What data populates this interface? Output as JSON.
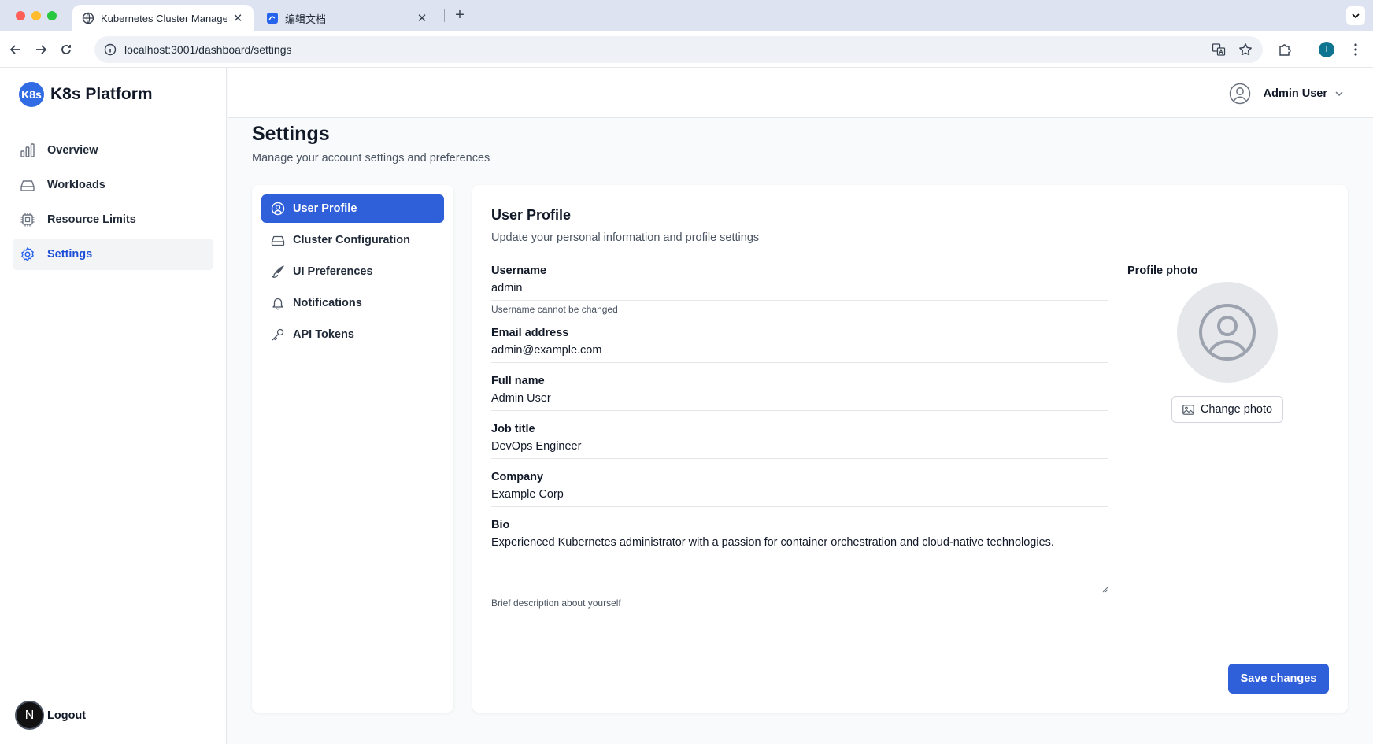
{
  "browser": {
    "tabs": [
      {
        "title": "Kubernetes Cluster Managem",
        "active": true
      },
      {
        "title": "编辑文档",
        "active": false
      }
    ],
    "new_tab": "+",
    "url": "localhost:3001/dashboard/settings",
    "profile_initial": "I"
  },
  "sidebar": {
    "brand_logo": "K8s",
    "brand_name": "K8s Platform",
    "items": [
      {
        "label": "Overview",
        "icon": "bar-chart-icon"
      },
      {
        "label": "Workloads",
        "icon": "hard-drive-icon"
      },
      {
        "label": "Resource Limits",
        "icon": "cpu-icon"
      },
      {
        "label": "Settings",
        "icon": "gear-icon",
        "active": true
      }
    ],
    "logout_badge": "N",
    "logout_label": "Logout"
  },
  "header": {
    "user_name": "Admin User"
  },
  "page": {
    "title": "Settings",
    "subtitle": "Manage your account settings and preferences"
  },
  "settings_nav": [
    {
      "label": "User Profile",
      "icon": "user-circle-icon",
      "active": true
    },
    {
      "label": "Cluster Configuration",
      "icon": "hard-drive-icon"
    },
    {
      "label": "UI Preferences",
      "icon": "brush-icon"
    },
    {
      "label": "Notifications",
      "icon": "bell-icon"
    },
    {
      "label": "API Tokens",
      "icon": "key-icon"
    }
  ],
  "profile": {
    "title": "User Profile",
    "subtitle": "Update your personal information and profile settings",
    "fields": {
      "username": {
        "label": "Username",
        "value": "admin",
        "help": "Username cannot be changed"
      },
      "email": {
        "label": "Email address",
        "value": "admin@example.com"
      },
      "full_name": {
        "label": "Full name",
        "value": "Admin User"
      },
      "job_title": {
        "label": "Job title",
        "value": "DevOps Engineer"
      },
      "company": {
        "label": "Company",
        "value": "Example Corp"
      },
      "bio": {
        "label": "Bio",
        "value": "Experienced Kubernetes administrator with a passion for container orchestration and cloud-native technologies.",
        "help": "Brief description about yourself"
      }
    },
    "photo_label": "Profile photo",
    "change_photo": "Change photo",
    "save": "Save changes"
  },
  "colors": {
    "primary": "#2f5fd9",
    "brand": "#326ce5",
    "active_text": "#1d4ed8"
  }
}
